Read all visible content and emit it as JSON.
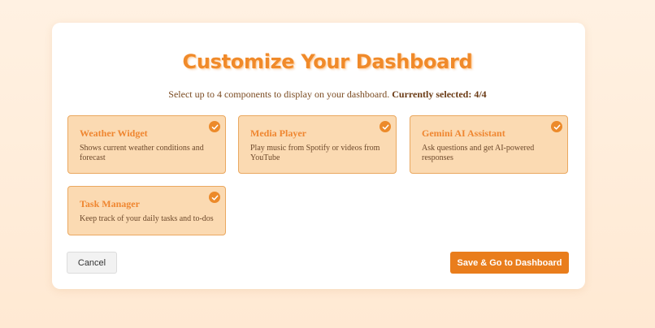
{
  "page": {
    "title": "Customize Your Dashboard",
    "subtitle_text": "Select up to 4 components to display on your dashboard.",
    "selected_label": "Currently selected: 4/4"
  },
  "components": [
    {
      "name": "Weather Widget",
      "description": "Shows current weather conditions and forecast",
      "selected": true
    },
    {
      "name": "Media Player",
      "description": "Play music from Spotify or videos from YouTube",
      "selected": true
    },
    {
      "name": "Gemini AI Assistant",
      "description": "Ask questions and get AI-powered responses",
      "selected": true
    },
    {
      "name": "Task Manager",
      "description": "Keep track of your daily tasks and to-dos",
      "selected": true
    }
  ],
  "actions": {
    "cancel_label": "Cancel",
    "save_label": "Save & Go to Dashboard"
  },
  "icons": {
    "selected": "check-circle-icon"
  },
  "colors": {
    "accent": "#e97d1c",
    "card_background": "#fbdab2",
    "card_border": "#eaa860",
    "title": "#f08a2a"
  }
}
